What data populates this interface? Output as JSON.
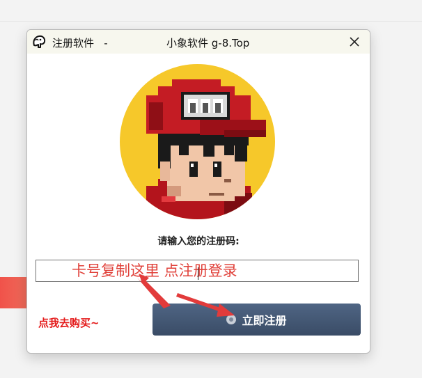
{
  "window": {
    "title_left": "注册软件   -",
    "title_center": "小象软件 g-8.Top",
    "close_icon": "close-icon",
    "app_icon": "elephant-logo-icon"
  },
  "main": {
    "prompt": "请输入您的注册码:",
    "input_value": "",
    "input_hint": "卡号复制这里 点注册登录",
    "buy_link": "点我去购买~",
    "register_button_label": "立即注册",
    "register_button_icon": "radio-dot-icon"
  },
  "colors": {
    "button_bg": "#44597a",
    "hint_red": "#e0413a",
    "buy_red": "#e41b1b",
    "avatar_bg": "#f6c82a"
  }
}
